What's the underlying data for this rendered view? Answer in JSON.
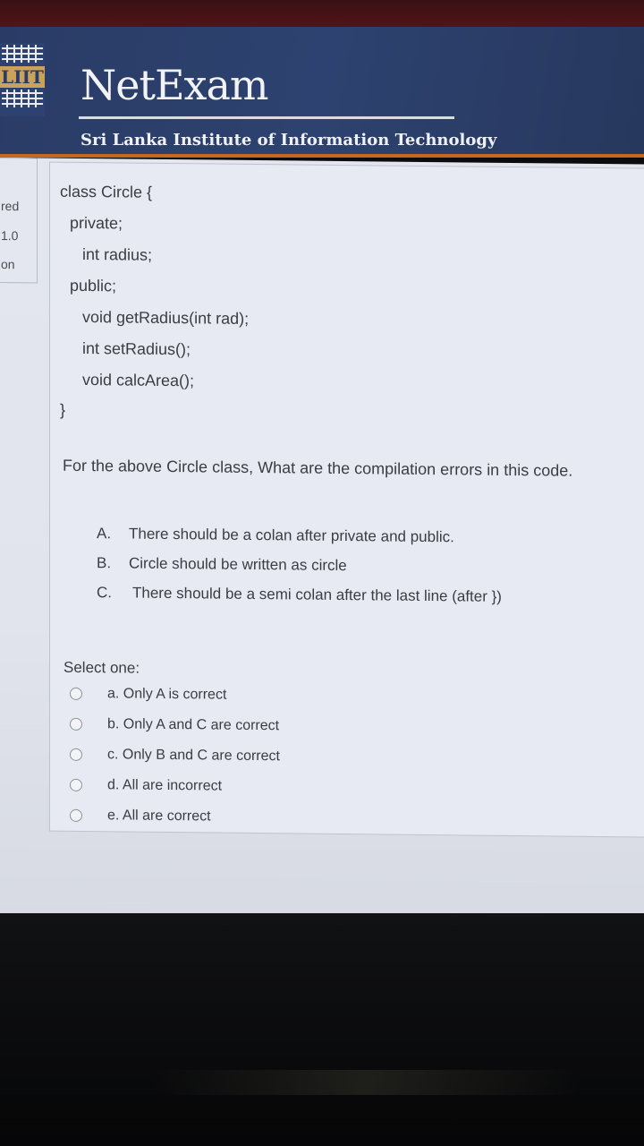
{
  "header": {
    "logo_text": "LIIT",
    "brand_title": "NetExam",
    "subtitle": "Sri Lanka Institute of Information Technology"
  },
  "sidebar": {
    "line1": "red",
    "line2": "1.0",
    "line3": "on"
  },
  "question": {
    "code": [
      "class Circle {",
      "private;",
      "int radius;",
      "public;",
      "void getRadius(int rad);",
      "int setRadius();",
      "void calcArea();",
      "}"
    ],
    "prompt": "For the above Circle class, What are the compilation errors in this code.",
    "statements": [
      {
        "letter": "A.",
        "text": "There should be a colan after private and public."
      },
      {
        "letter": "B.",
        "text": "Circle should be written as circle"
      },
      {
        "letter": "C.",
        "text": "There should be a semi colan after the last line (after })"
      }
    ],
    "select_label": "Select one:",
    "choices": [
      "a. Only A is correct",
      "b. Only A and C are correct",
      "c. Only B and C are correct",
      "d. All are incorrect",
      "e. All are correct"
    ]
  },
  "colors": {
    "header_bg": "#2d4270",
    "header_accent": "#c4691f",
    "page_bg": "#e3e6ef"
  }
}
